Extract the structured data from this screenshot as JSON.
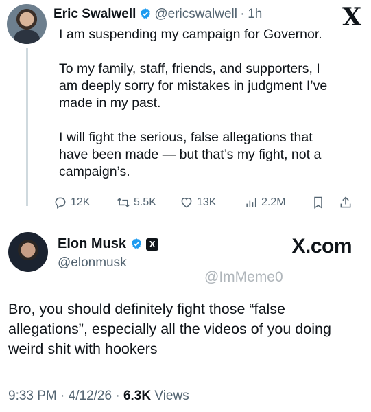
{
  "tweet": {
    "author_name": "Eric Swalwell",
    "author_handle": "@ericswalwell",
    "separator": "·",
    "time": "1h",
    "lines": [
      "I am suspending my campaign for Governor.",
      "",
      "To my family, staff, friends, and supporters, I",
      "am deeply sorry for mistakes in judgment I’ve",
      "made in my past.",
      "",
      "I will fight the serious, false allegations that",
      "have been made — but that’s my fight, not a",
      "campaign’s."
    ],
    "stats": {
      "replies": "12K",
      "reposts": "5.5K",
      "likes": "13K",
      "views": "2.2M"
    },
    "platform_logo": "X"
  },
  "reply": {
    "author_name": "Elon Musk",
    "author_handle": "@elonmusk",
    "badge_letter": "X",
    "site_label": "X.com",
    "watermark": "@ImMeme0",
    "text": "Bro, you should definitely fight those “false allegations”, especially all the videos of you doing weird shit with hookers",
    "time": "9:33 PM",
    "date": "4/12/26",
    "views_count": "6.3K",
    "views_label": "Views",
    "meta_sep": "·"
  },
  "colors": {
    "verified_blue": "#1d9bf0",
    "text": "#0f1419",
    "secondary": "#536471",
    "thread_line": "#cfd9de"
  },
  "icons": [
    "verified-icon",
    "reply-icon",
    "repost-icon",
    "like-icon",
    "views-icon",
    "bookmark-icon",
    "share-icon",
    "x-logo-icon"
  ]
}
